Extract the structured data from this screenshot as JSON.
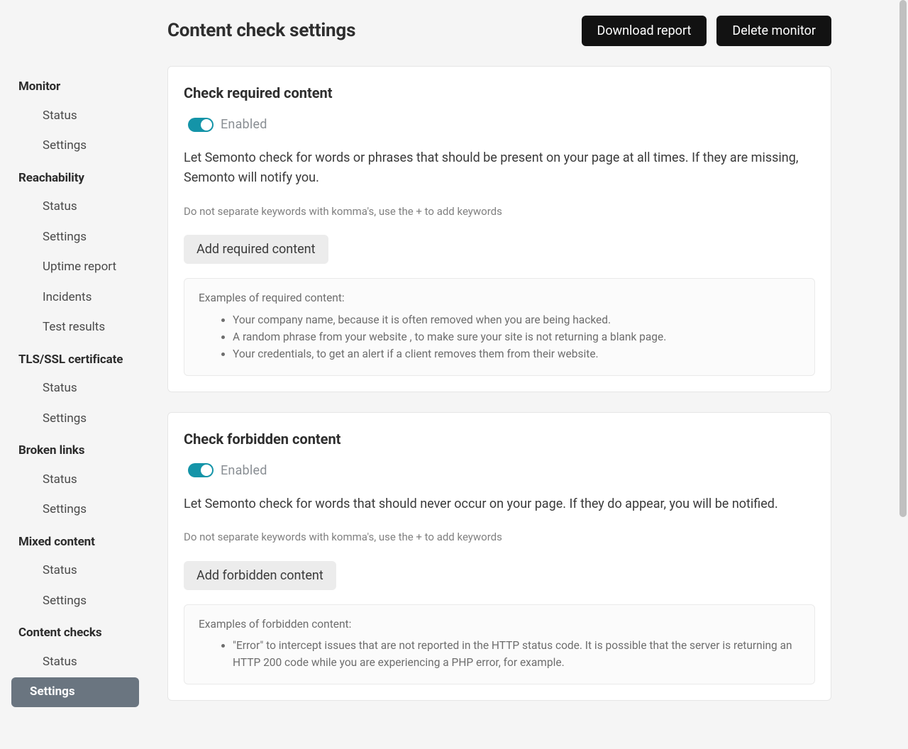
{
  "header": {
    "title": "Content check settings",
    "download_label": "Download report",
    "delete_label": "Delete monitor"
  },
  "sidebar": {
    "groups": [
      {
        "heading": "Monitor",
        "items": [
          {
            "label": "Status",
            "active": false
          },
          {
            "label": "Settings",
            "active": false
          }
        ]
      },
      {
        "heading": "Reachability",
        "items": [
          {
            "label": "Status",
            "active": false
          },
          {
            "label": "Settings",
            "active": false
          },
          {
            "label": "Uptime report",
            "active": false
          },
          {
            "label": "Incidents",
            "active": false
          },
          {
            "label": "Test results",
            "active": false
          }
        ]
      },
      {
        "heading": "TLS/SSL certificate",
        "items": [
          {
            "label": "Status",
            "active": false
          },
          {
            "label": "Settings",
            "active": false
          }
        ]
      },
      {
        "heading": "Broken links",
        "items": [
          {
            "label": "Status",
            "active": false
          },
          {
            "label": "Settings",
            "active": false
          }
        ]
      },
      {
        "heading": "Mixed content",
        "items": [
          {
            "label": "Status",
            "active": false
          },
          {
            "label": "Settings",
            "active": false
          }
        ]
      },
      {
        "heading": "Content checks",
        "items": [
          {
            "label": "Status",
            "active": false
          },
          {
            "label": "Settings",
            "active": true
          }
        ]
      }
    ]
  },
  "cards": {
    "required": {
      "title": "Check required content",
      "enabled": true,
      "enabled_label": "Enabled",
      "description": "Let Semonto check for words or phrases that should be present on your page at all times. If they are missing, Semonto will notify you.",
      "hint": "Do not separate keywords with komma's, use the + to add keywords",
      "add_button": "Add required content",
      "examples_title": "Examples of required content:",
      "examples": [
        "Your company name, because it is often removed when you are being hacked.",
        "A random phrase from your website , to make sure your site is not returning a blank page.",
        "Your credentials, to get an alert if a client removes them from their website."
      ]
    },
    "forbidden": {
      "title": "Check forbidden content",
      "enabled": true,
      "enabled_label": "Enabled",
      "description": "Let Semonto check for words that should never occur on your page. If they do appear, you will be notified.",
      "hint": "Do not separate keywords with komma's, use the + to add keywords",
      "add_button": "Add forbidden content",
      "examples_title": "Examples of forbidden content:",
      "examples": [
        "\"Error\" to intercept issues that are not reported in the HTTP status code. It is possible that the server is returning an HTTP 200 code while you are experiencing a PHP error, for example."
      ]
    }
  }
}
